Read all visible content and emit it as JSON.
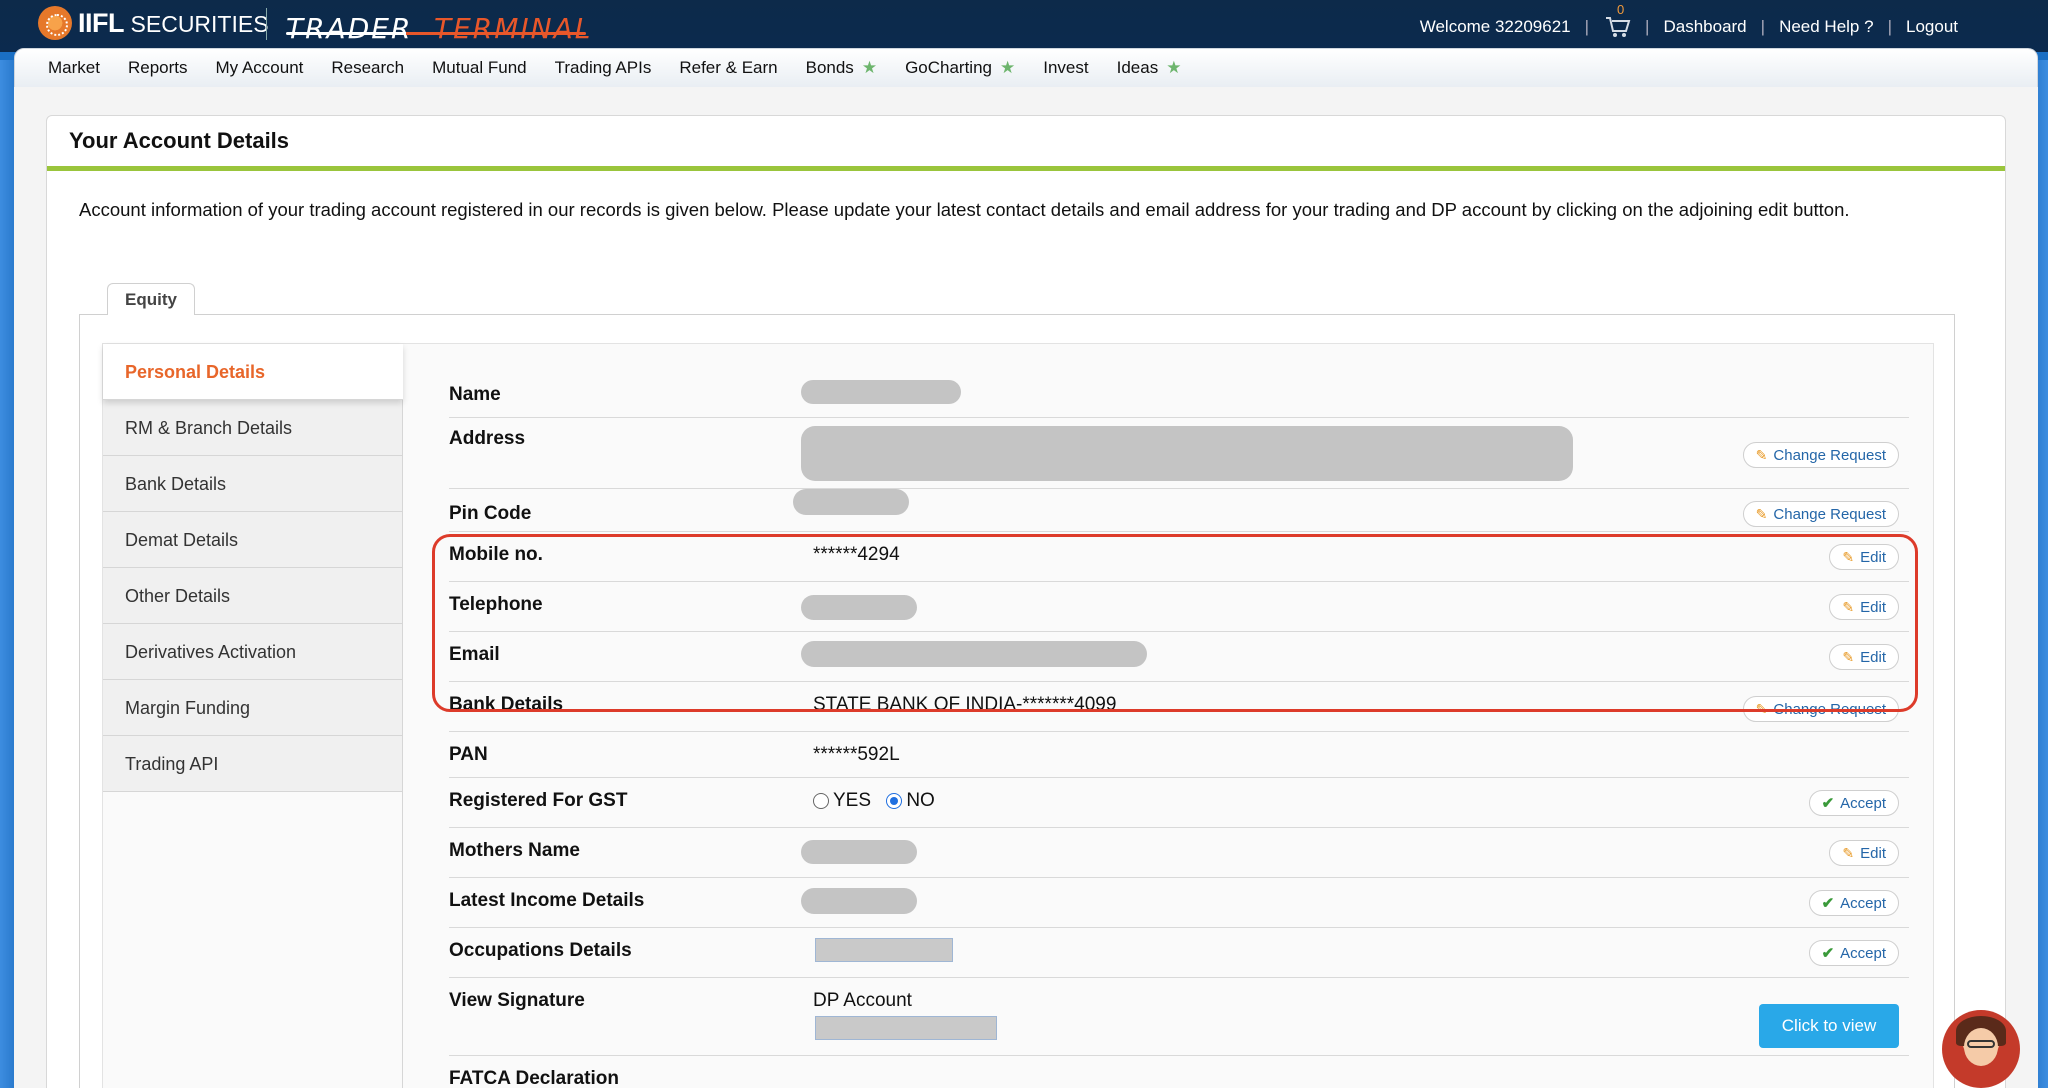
{
  "brand": {
    "name": "IIFL",
    "sub": "SECURITIES",
    "terminal_left": "TRADER",
    "terminal_right": "TERMINAL"
  },
  "header": {
    "welcome": "Welcome 32209621",
    "cart_count": "0",
    "dashboard": "Dashboard",
    "help": "Need Help ?",
    "logout": "Logout"
  },
  "nav": [
    {
      "label": "Market",
      "star": false
    },
    {
      "label": "Reports",
      "star": false
    },
    {
      "label": "My Account",
      "star": false
    },
    {
      "label": "Research",
      "star": false
    },
    {
      "label": "Mutual Fund",
      "star": false
    },
    {
      "label": "Trading APIs",
      "star": false
    },
    {
      "label": "Refer & Earn",
      "star": false
    },
    {
      "label": "Bonds",
      "star": true
    },
    {
      "label": "GoCharting",
      "star": true
    },
    {
      "label": "Invest",
      "star": false
    },
    {
      "label": "Ideas",
      "star": true
    }
  ],
  "page": {
    "title": "Your Account Details",
    "intro": "Account information of your trading account registered in our records is given below. Please update your latest contact details and email address for your trading and DP account by clicking on the adjoining edit button.",
    "tab": "Equity"
  },
  "sidebar": [
    {
      "label": "Personal Details",
      "active": true
    },
    {
      "label": "RM & Branch Details",
      "active": false
    },
    {
      "label": "Bank Details",
      "active": false
    },
    {
      "label": "Demat Details",
      "active": false
    },
    {
      "label": "Other Details",
      "active": false
    },
    {
      "label": "Derivatives Activation",
      "active": false
    },
    {
      "label": "Margin Funding",
      "active": false
    },
    {
      "label": "Trading API",
      "active": false
    }
  ],
  "details": {
    "name": {
      "label": "Name"
    },
    "address": {
      "label": "Address",
      "action": "Change Request"
    },
    "pincode": {
      "label": "Pin Code",
      "action": "Change Request"
    },
    "mobile": {
      "label": "Mobile no.",
      "value": "******4294",
      "action": "Edit"
    },
    "telephone": {
      "label": "Telephone",
      "action": "Edit"
    },
    "email": {
      "label": "Email",
      "action": "Edit"
    },
    "bank": {
      "label": "Bank Details",
      "value": "STATE BANK OF INDIA-*******4099",
      "action": "Change Request"
    },
    "pan": {
      "label": "PAN",
      "value": "******592L"
    },
    "gst": {
      "label": "Registered For GST",
      "yes": "YES",
      "no": "NO",
      "selected": "NO",
      "action": "Accept"
    },
    "mothers": {
      "label": "Mothers Name",
      "action": "Edit"
    },
    "income": {
      "label": "Latest Income Details",
      "action": "Accept"
    },
    "occupation": {
      "label": "Occupations Details",
      "action": "Accept"
    },
    "signature": {
      "label": "View Signature",
      "value": "DP Account",
      "action": "Click to view"
    },
    "fatca": {
      "label": "FATCA Declaration"
    }
  }
}
